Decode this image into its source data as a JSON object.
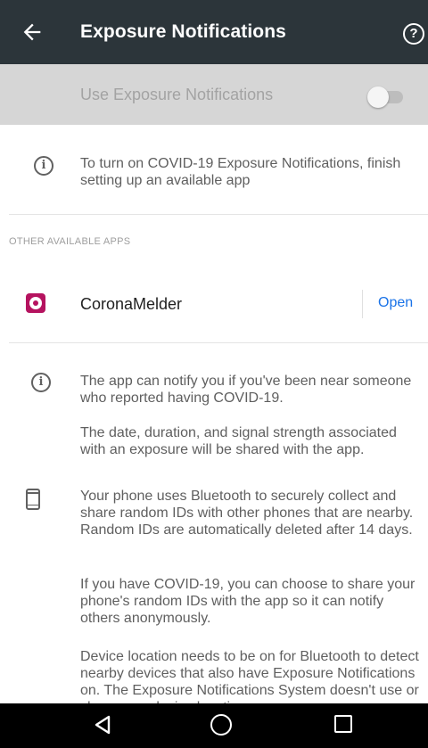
{
  "header": {
    "title": "Exposure Notifications",
    "back_icon": "arrow-back-icon",
    "help_icon": "help-circle-icon",
    "help_glyph": "?"
  },
  "toggle": {
    "label": "Use Exposure Notifications",
    "state": "off"
  },
  "notice": {
    "icon": "info-icon",
    "glyph": "i",
    "text": "To turn on COVID-19 Exposure Notifications, finish setting up an available app"
  },
  "apps_section": {
    "header": "OTHER AVAILABLE APPS",
    "apps": [
      {
        "name": "CoronaMelder",
        "action": "Open",
        "icon": "coronamelder-app-icon"
      }
    ]
  },
  "info": {
    "glyph": "i",
    "p1": "The app can notify you if you've been near someone who reported having COVID-19.",
    "p2": "The date, duration, and signal strength associated with an exposure will be shared with the app.",
    "phone_icon": "phone-icon",
    "p3": "Your phone uses Bluetooth to securely collect and share random IDs with other phones that are nearby. Random IDs are automatically deleted after 14 days.",
    "p4": "If you have COVID-19, you can choose to share your phone's random IDs with the app so it can notify others anonymously.",
    "p5": "Device location needs to be on for Bluetooth to detect nearby devices that also have Exposure Notifications on. The Exposure Notifications System doesn't use or share your device location"
  },
  "navbar": {
    "back": "nav-back-icon",
    "home": "nav-home-icon",
    "recents": "nav-recents-icon"
  },
  "colors": {
    "appbar": "#2c353a",
    "link": "#1a73e8",
    "app_icon": "#b5135f"
  }
}
